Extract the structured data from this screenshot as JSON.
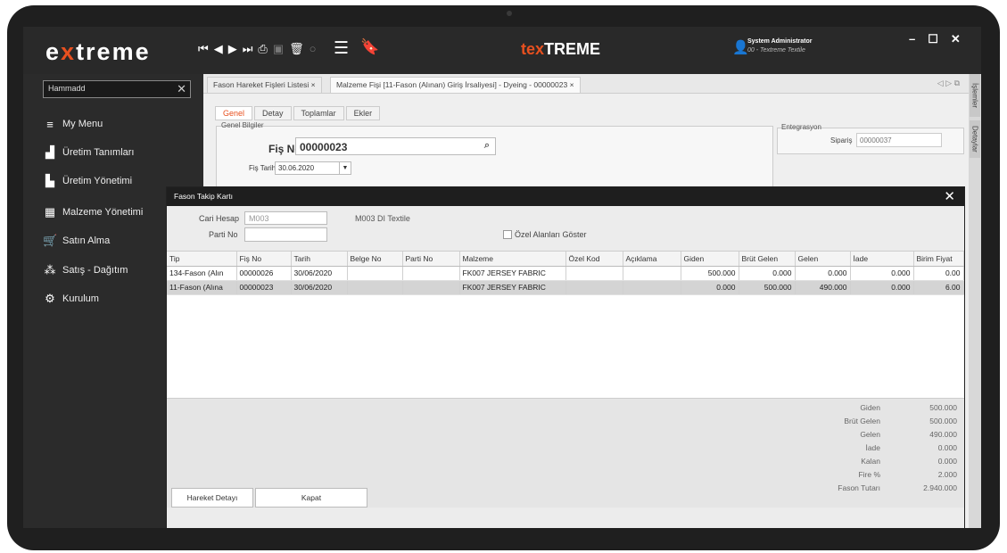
{
  "app": {
    "logo_pre": "e",
    "logo_x": "x",
    "logo_post": "treme",
    "brand_tex": "tex",
    "brand_treme": "TREME",
    "user_name": "System Administrator",
    "user_company": "00 - Textreme Textile",
    "accent": "#e8501f"
  },
  "sidebar": {
    "search_value": "Hammadd",
    "items": [
      {
        "label": "My Menu",
        "icon": "menu-star-icon"
      },
      {
        "label": "Üretim Tanımları",
        "icon": "factory-icon"
      },
      {
        "label": "Üretim Yönetimi",
        "icon": "factory-roof-icon"
      },
      {
        "label": "Malzeme Yönetimi",
        "icon": "boxes-icon"
      },
      {
        "label": "Satın Alma",
        "icon": "cart-icon"
      },
      {
        "label": "Satış - Dağıtım",
        "icon": "network-icon"
      },
      {
        "label": "Kurulum",
        "icon": "gear-icon"
      }
    ]
  },
  "tabs": {
    "tab1": "Fason Hareket Fişleri Listesi",
    "tab2": "Malzeme Fişi  [11-Fason (Alınan) Giriş İrsaliyesi]  - Dyeing - 00000023",
    "close": "×"
  },
  "rightstrip": {
    "islemler": "İşlemler",
    "detaylar": "Detaylar"
  },
  "form": {
    "subtabs": [
      "Genel",
      "Detay",
      "Toplamlar",
      "Ekler"
    ],
    "group_label": "Genel Bilgiler",
    "fisno_label": "Fiş No",
    "fisno_value": "00000023",
    "tarih_label": "Fiş Tarihi",
    "tarih_value": "30.06.2020",
    "entegrasyon_label": "Entegrasyon",
    "siparis_label": "Sipariş",
    "siparis_value": "00000037"
  },
  "dialog": {
    "title": "Fason Takip Kartı",
    "cari_label": "Cari Hesap",
    "cari_value": "M003",
    "cari_name": "M003  DI Textile",
    "parti_label": "Parti No",
    "ozel_label": "Özel Alanları Göster",
    "columns": [
      "Tip",
      "Fiş No",
      "Tarih",
      "Belge No",
      "Parti No",
      "Malzeme",
      "Özel Kod",
      "Açıklama",
      "Giden",
      "Brüt Gelen",
      "Gelen",
      "İade",
      "Birim Fiyat"
    ],
    "rows": [
      {
        "tip": "134-Fason (Alın",
        "fisno": "00000026",
        "tarih": "30/06/2020",
        "belge": "",
        "parti": "",
        "malzeme": "FK007 JERSEY FABRIC",
        "ozel": "",
        "aciklama": "",
        "giden": "500.000",
        "brut": "0.000",
        "gelen": "0.000",
        "iade": "0.000",
        "fiyat": "0.00"
      },
      {
        "tip": "11-Fason (Alına",
        "fisno": "00000023",
        "tarih": "30/06/2020",
        "belge": "",
        "parti": "",
        "malzeme": "FK007 JERSEY FABRIC",
        "ozel": "",
        "aciklama": "",
        "giden": "0.000",
        "brut": "500.000",
        "gelen": "490.000",
        "iade": "0.000",
        "fiyat": "6.00"
      }
    ],
    "summary": [
      {
        "label": "Giden",
        "value": "500.000"
      },
      {
        "label": "Brüt Gelen",
        "value": "500.000"
      },
      {
        "label": "Gelen",
        "value": "490.000"
      },
      {
        "label": "İade",
        "value": "0.000"
      },
      {
        "label": "Kalan",
        "value": "0.000"
      },
      {
        "label": "Fire %",
        "value": "2.000"
      },
      {
        "label": "Fason Tutarı",
        "value": "2.940.000"
      }
    ],
    "btn_detay": "Hareket Detayı",
    "btn_kapat": "Kapat"
  }
}
